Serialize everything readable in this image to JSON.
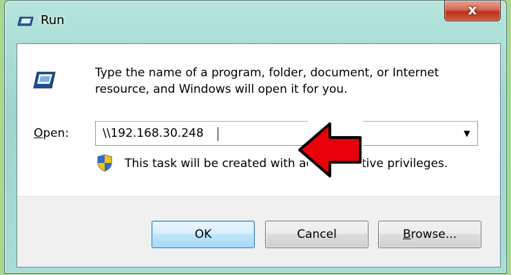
{
  "window": {
    "title": "Run",
    "close_label": "x"
  },
  "dialog": {
    "description": "Type the name of a program, folder, document, or Internet resource, and Windows will open it for you.",
    "open_label_prefix": "O",
    "open_label_rest": "pen:",
    "open_value": "\\\\192.168.30.248",
    "dropdown_glyph": "▼",
    "admin_note": "This task will be created with administrative privileges."
  },
  "buttons": {
    "ok": "OK",
    "cancel": "Cancel",
    "browse_prefix": "B",
    "browse_rest": "rowse..."
  },
  "colors": {
    "frame": "#a8dcd6",
    "close_button": "#c7462c",
    "ok_border": "#3c7fb1",
    "annotation_arrow": "#e8000b"
  },
  "icons": [
    "run-icon",
    "shield-icon",
    "red-arrow-annotation"
  ]
}
